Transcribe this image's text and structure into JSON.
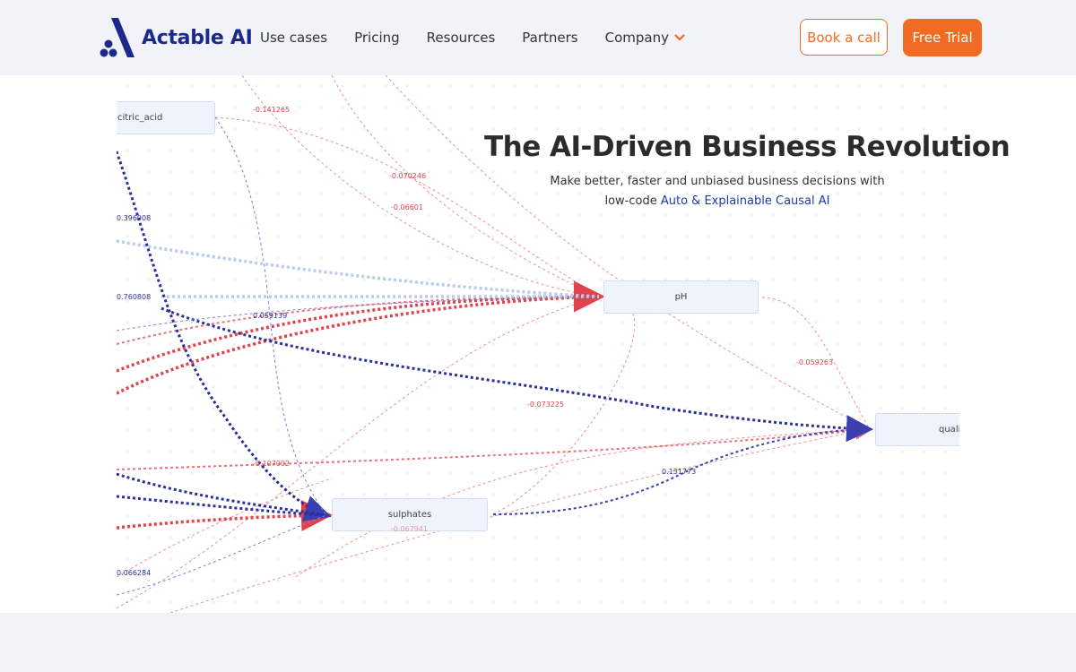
{
  "brand": {
    "name": "Actable AI",
    "logo_color": "#1b2a88"
  },
  "nav": {
    "links": [
      "Use cases",
      "Pricing",
      "Resources",
      "Partners"
    ],
    "company_label": "Company",
    "chevron_icon": "chevron-down-icon"
  },
  "actions": {
    "book_call": "Book a call",
    "free_trial": "Free Trial",
    "accent_color": "#f26b22"
  },
  "hero": {
    "title": "The AI-Driven Business Revolution",
    "subtitle_line1": "Make better, faster and unbiased business decisions with",
    "subtitle_prefix": "low-code ",
    "subtitle_link": "Auto & Explainable Causal AI"
  },
  "graph": {
    "nodes": {
      "citric_acid": "citric_acid",
      "ph": "pH",
      "quality": "quali",
      "sulphates": "sulphates"
    },
    "edge_labels": {
      "e1": "-0.141265",
      "e2": "-0.070246",
      "e3": "-0.06601",
      "e4": "0.396908",
      "e5": "0.760808",
      "e6": "0.059139",
      "e7": "-0.059263",
      "e8": "-0.073225",
      "e9": "-0.107002",
      "e10": "0.131773",
      "e11": "-0.067941",
      "e12": "0.066284"
    },
    "colors": {
      "positive": "#2a2f9a",
      "negative": "#e0434c",
      "light": "#b9cdea"
    }
  }
}
